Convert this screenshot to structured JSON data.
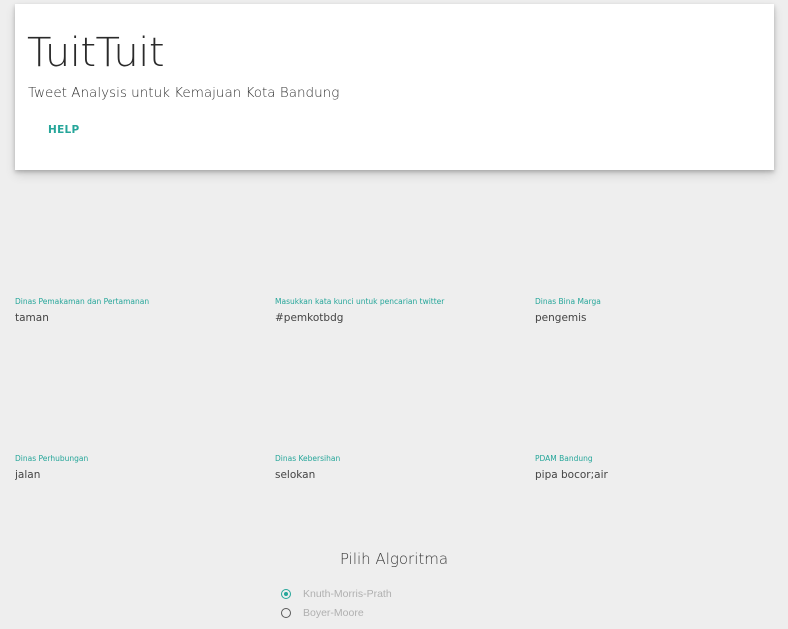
{
  "header": {
    "title": "TuitTuit",
    "subtitle": "Tweet Analysis untuk Kemajuan Kota Bandung",
    "help_label": "HELP"
  },
  "fields": [
    {
      "label": "Dinas Pemakaman dan Pertamanan",
      "value": "taman"
    },
    {
      "label": "Masukkan kata kunci untuk pencarian twitter",
      "value": "#pemkotbdg"
    },
    {
      "label": "Dinas Bina Marga",
      "value": "pengemis"
    },
    {
      "label": "Dinas Perhubungan",
      "value": "jalan"
    },
    {
      "label": "Dinas Kebersihan",
      "value": "selokan"
    },
    {
      "label": "PDAM Bandung",
      "value": "pipa bocor;air"
    }
  ],
  "algorithm": {
    "title": "Pilih Algoritma",
    "options": [
      {
        "label": "Knuth-Morris-Prath",
        "selected": true
      },
      {
        "label": "Boyer-Moore",
        "selected": false
      }
    ]
  },
  "colors": {
    "accent": "#26a69a",
    "background": "#eeeeee",
    "card": "#ffffff"
  }
}
